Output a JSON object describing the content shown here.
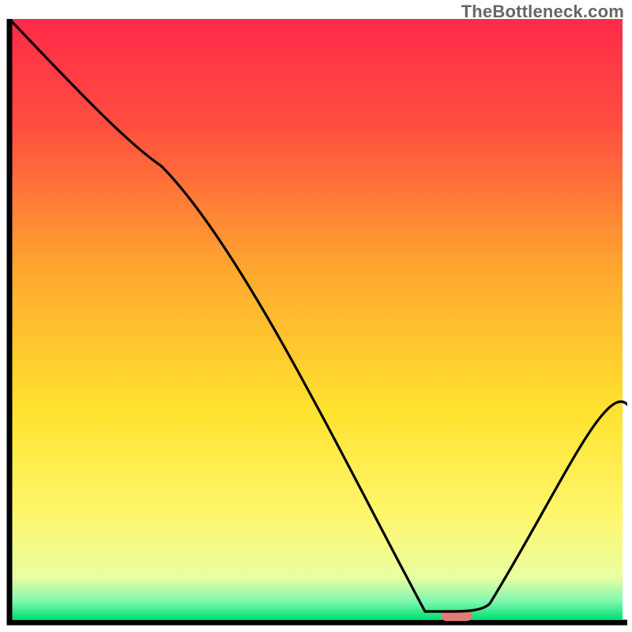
{
  "watermark": "TheBottleneck.com",
  "chart_data": {
    "type": "line",
    "title": "",
    "xlabel": "",
    "ylabel": "",
    "xlim": [
      0,
      100
    ],
    "ylim": [
      0,
      100
    ],
    "x": [
      0,
      25,
      68,
      72,
      78,
      100
    ],
    "values": [
      100,
      76,
      2,
      2,
      2,
      36
    ],
    "curve_points": {
      "x": [
        0,
        25,
        68,
        72,
        78,
        100
      ],
      "y": [
        100,
        76,
        2,
        2,
        2,
        36
      ]
    },
    "marker": {
      "x_range": [
        71,
        76
      ],
      "y": 1,
      "color": "#e27a78"
    },
    "background_gradient_stops": [
      {
        "pct": 0,
        "color": "#ff2a4a"
      },
      {
        "pct": 18,
        "color": "#ff4f3f"
      },
      {
        "pct": 42,
        "color": "#ffa82f"
      },
      {
        "pct": 65,
        "color": "#ffe22f"
      },
      {
        "pct": 82,
        "color": "#fff66a"
      },
      {
        "pct": 93,
        "color": "#e9ffa0"
      },
      {
        "pct": 97,
        "color": "#7ff7b0"
      },
      {
        "pct": 100,
        "color": "#00e070"
      }
    ],
    "axes_color": "#000000",
    "grid": false,
    "legend": null
  }
}
